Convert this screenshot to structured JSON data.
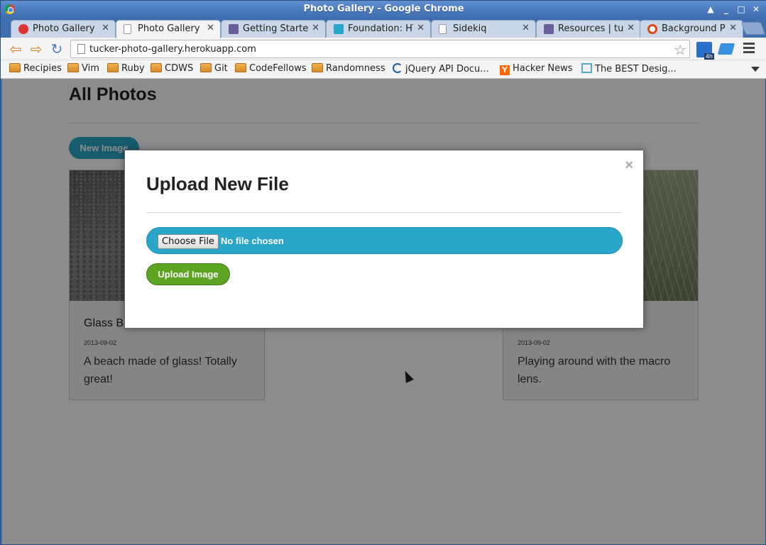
{
  "window": {
    "title": "Photo Gallery - Google Chrome"
  },
  "tabs": [
    {
      "label": "Photo Gallery",
      "icon": "red-shield-icon",
      "active": false
    },
    {
      "label": "Photo Gallery",
      "icon": "page-icon",
      "active": true
    },
    {
      "label": "Getting Startec",
      "icon": "heroku-icon",
      "active": false
    },
    {
      "label": "Foundation: HT",
      "icon": "foundation-icon",
      "active": false
    },
    {
      "label": "Sidekiq",
      "icon": "page-icon",
      "active": false
    },
    {
      "label": "Resources | tuc",
      "icon": "heroku-icon",
      "active": false
    },
    {
      "label": "Background Ph",
      "icon": "ubuntu-icon",
      "active": false
    }
  ],
  "toolbar": {
    "url": "tucker-photo-gallery.herokuapp.com",
    "ext_badge": "4h"
  },
  "bookmarks": [
    {
      "label": "Recipies",
      "type": "folder"
    },
    {
      "label": "Vim",
      "type": "folder"
    },
    {
      "label": "Ruby",
      "type": "folder"
    },
    {
      "label": "CDWS",
      "type": "folder"
    },
    {
      "label": "Git",
      "type": "folder"
    },
    {
      "label": "CodeFellows",
      "type": "folder"
    },
    {
      "label": "Randomness",
      "type": "folder"
    },
    {
      "label": "jQuery API Docu...",
      "type": "jquery"
    },
    {
      "label": "Hacker News",
      "type": "yc"
    },
    {
      "label": "The BEST Desig...",
      "type": "site"
    }
  ],
  "page": {
    "title": "All Photos",
    "new_image_label": "New Image",
    "cards": [
      {
        "title": "Glass B",
        "date": "2013-09-02",
        "description": "A beach made of glass! Totally great!"
      },
      {
        "title": "",
        "date": "2013-09-02",
        "description": "Playing around with the macro lens."
      }
    ]
  },
  "modal": {
    "title": "Upload New File",
    "close": "×",
    "choose_file_label": "Choose File",
    "no_file_text": "No file chosen",
    "upload_label": "Upload Image"
  },
  "colors": {
    "accent_blue": "#2ba6cb",
    "success_green": "#5da423",
    "titlebar_blue": "#3f6eae"
  }
}
